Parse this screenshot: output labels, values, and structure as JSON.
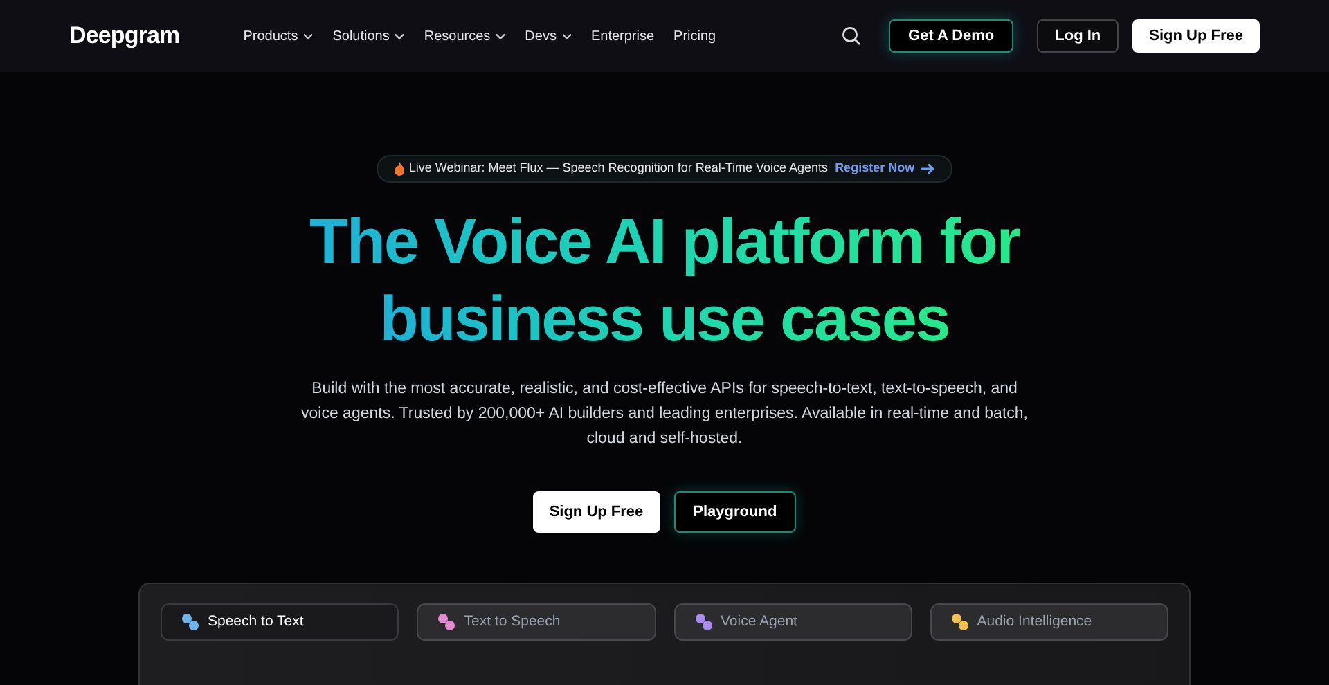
{
  "header": {
    "logo": "Deepgram",
    "nav": [
      {
        "label": "Products",
        "dropdown": true
      },
      {
        "label": "Solutions",
        "dropdown": true
      },
      {
        "label": "Resources",
        "dropdown": true
      },
      {
        "label": "Devs",
        "dropdown": true
      },
      {
        "label": "Enterprise",
        "dropdown": false
      },
      {
        "label": "Pricing",
        "dropdown": false
      }
    ],
    "demo_button": "Get A Demo",
    "login_button": "Log In",
    "signup_button": "Sign Up Free"
  },
  "announcement": {
    "text": "Live Webinar: Meet Flux — Speech Recognition for Real-Time Voice Agents",
    "link": "Register Now"
  },
  "hero": {
    "headline_lines": [
      "The Voice AI platform for",
      "business use cases"
    ],
    "description": "Build with the most accurate, realistic, and cost-effective APIs for speech-to-text, text-to-speech, and voice agents. Trusted by 200,000+ AI builders and leading enterprises. Available in real-time and batch, cloud and self-hosted.",
    "buttons": [
      {
        "label": "Sign Up Free",
        "kind": "primary"
      },
      {
        "label": "Playground",
        "kind": "outline"
      }
    ]
  },
  "product_tabs": [
    {
      "label": "Speech to Text",
      "selected": true,
      "color": "#6cb4f0"
    },
    {
      "label": "Text to Speech",
      "selected": false,
      "color": "#e58ad0"
    },
    {
      "label": "Voice Agent",
      "selected": false,
      "color": "#a98cf0"
    },
    {
      "label": "Audio Intelligence",
      "selected": false,
      "color": "#f2c14e"
    }
  ]
}
